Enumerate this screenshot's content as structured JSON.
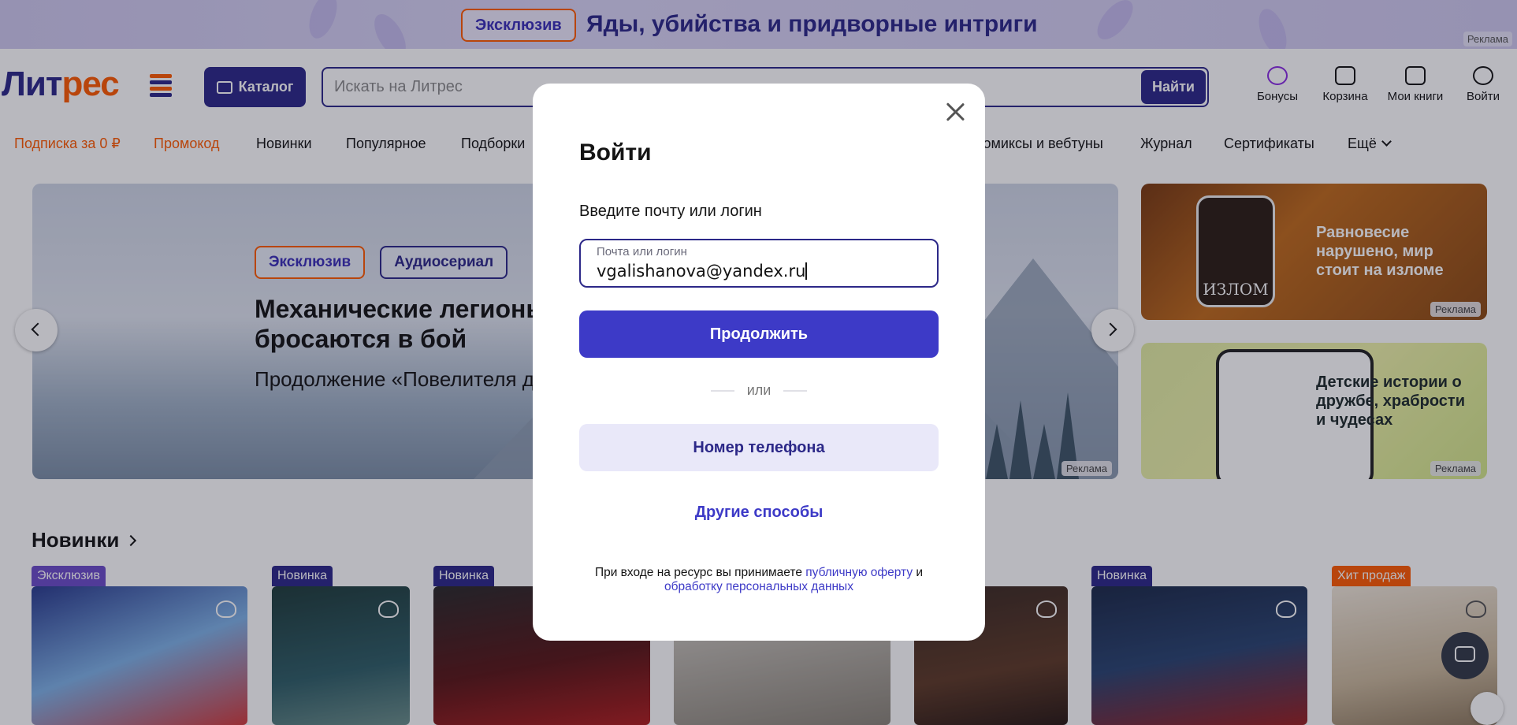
{
  "promo": {
    "badge": "Эксклюзив",
    "text": "Яды, убийства и придворные интриги",
    "ad_label": "Реклама"
  },
  "header": {
    "logo_part1": "Лит",
    "logo_part2": "рес",
    "catalog_label": "Каталог",
    "search_placeholder": "Искать на Литрес",
    "search_button": "Найти",
    "icons": [
      {
        "label": "Бонусы",
        "icon": "bonus-icon"
      },
      {
        "label": "Корзина",
        "icon": "cart-icon"
      },
      {
        "label": "Мои книги",
        "icon": "book-icon"
      },
      {
        "label": "Войти",
        "icon": "user-icon"
      }
    ]
  },
  "nav": {
    "items": [
      "Подписка за 0 ₽",
      "Промокод",
      "Новинки",
      "Популярное",
      "Подборки",
      "Комиксы и вебтуны",
      "Журнал",
      "Сертификаты",
      "Ещё"
    ]
  },
  "hero": {
    "badge_exclusive": "Эксклюзив",
    "badge_audio": "Аудиосериал",
    "title": "Механические легионы бросаются в бой",
    "subtitle": "Продолжение «Повелителя дронов»",
    "ad_label": "Реклама"
  },
  "side_banners": [
    {
      "text": "Равновесие нарушено, мир стоит на изломе",
      "book_title": "ИЗЛОМ",
      "ad_label": "Реклама"
    },
    {
      "text": "Детские истории о дружбе, храбрости и чудесах",
      "ad_label": "Реклама"
    }
  ],
  "section": {
    "title": "Новинки"
  },
  "cards": [
    {
      "tag": "Эксклюзив"
    },
    {
      "tag": "Новинка"
    },
    {
      "tag": "Новинка"
    },
    {
      "tag": "Новинка"
    },
    {
      "tag": "Хит продаж"
    }
  ],
  "modal": {
    "title": "Войти",
    "prompt": "Введите почту или логин",
    "field_label": "Почта или логин",
    "field_value": "vgalishanova@yandex.ru",
    "continue_button": "Продолжить",
    "or_text": "или",
    "phone_button": "Номер телефона",
    "other_methods": "Другие способы",
    "legal_prefix": "При входе на ресурс вы принимаете ",
    "legal_link1": "публичную оферту",
    "legal_mid": " и ",
    "legal_link2": "обработку персональных данных"
  },
  "colors": {
    "brand": "#2c2888",
    "accent": "#ff5b00",
    "primary_button": "#3d3ac7"
  }
}
